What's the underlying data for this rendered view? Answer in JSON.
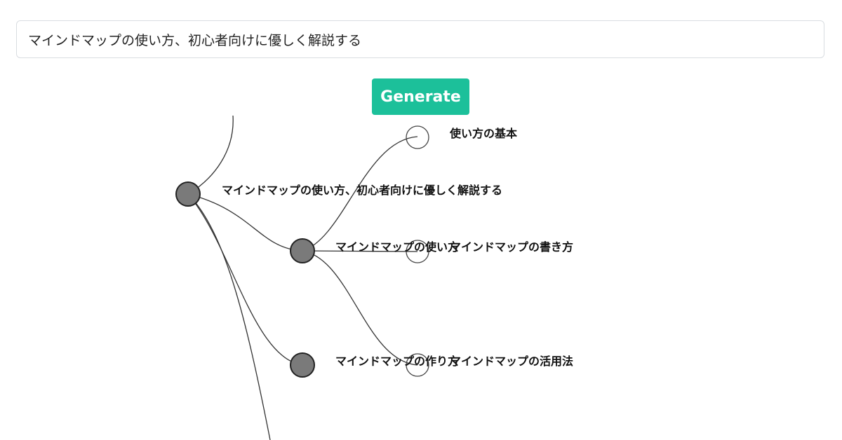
{
  "topic_input": {
    "value": "マインドマップの使い方、初心者向けに優しく解説する"
  },
  "generate_button": {
    "label": "Generate",
    "color": "#1cc09a"
  },
  "mindmap": {
    "root": {
      "label": "マインドマップの使い方、初心者向けに優しく解説する"
    },
    "branches": [
      {
        "label": "マインドマップの使い方"
      },
      {
        "label": "マインドマップの作り方"
      }
    ],
    "leaves": [
      {
        "label": "使い方の基本"
      },
      {
        "label": "マインドマップの書き方"
      },
      {
        "label": "マインドマップの活用法"
      }
    ],
    "colors": {
      "filled_node": "#7a7a7a",
      "link": "#333333"
    }
  }
}
